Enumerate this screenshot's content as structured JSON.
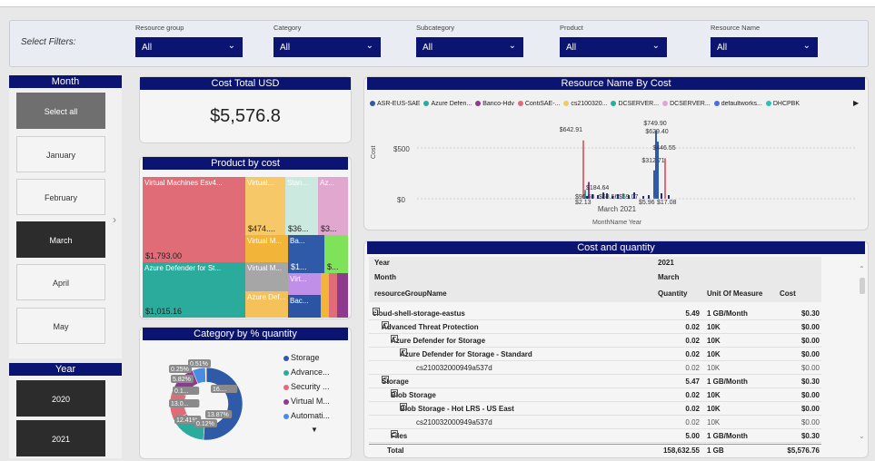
{
  "filters": {
    "label": "Select Filters:",
    "items": [
      {
        "label": "Resource group",
        "value": "All"
      },
      {
        "label": "Category",
        "value": "All"
      },
      {
        "label": "Subcategory",
        "value": "All"
      },
      {
        "label": "Product",
        "value": "All"
      },
      {
        "label": "Resource Name",
        "value": "All"
      }
    ]
  },
  "month_slicer": {
    "title": "Month",
    "items": [
      "Select all",
      "January",
      "February",
      "March",
      "April",
      "May"
    ],
    "selected": "March"
  },
  "year_slicer": {
    "title": "Year",
    "items": [
      "2020",
      "2021"
    ]
  },
  "cost_card": {
    "title": "Cost Total USD",
    "value": "$5,576.8"
  },
  "product_chart": {
    "title": "Product by cost",
    "tiles": [
      {
        "label": "Virtual Machines Esv4...",
        "value": "$1,793.00",
        "color": "#e06c78"
      },
      {
        "label": "Azure Defender for St...",
        "value": "$1,015.16",
        "color": "#2bab9b"
      },
      {
        "label": "Virtual...",
        "value": "$474....",
        "color": "#f7c867"
      },
      {
        "label": "Stan...",
        "value": "$36...",
        "color": "#cce9df"
      },
      {
        "label": "Az...",
        "value": "$3...",
        "color": "#e2a7ce"
      },
      {
        "label": "Virtual M...",
        "value": "",
        "color": "#f2b53a"
      },
      {
        "label": "Ba...",
        "value": "$1...",
        "color": "#2f5aa8"
      },
      {
        "label": "",
        "value": "$...",
        "color": "#7fe35a"
      },
      {
        "label": "Virtual M...",
        "value": "",
        "color": "#a6a6a6"
      },
      {
        "label": "Virt...",
        "value": "",
        "color": "#c08fe8"
      },
      {
        "label": "Azure Def...",
        "value": "",
        "color": "#f5c15b"
      },
      {
        "label": "Bac...",
        "value": "",
        "color": "#2b55a3"
      }
    ]
  },
  "category_chart": {
    "title": "Category by % quantity",
    "slices": [
      {
        "name": "Storage",
        "value": 51.0,
        "color": "#2f5aa8"
      },
      {
        "name": "Advance...",
        "value": 16.0,
        "color": "#2bab9b"
      },
      {
        "name": "Security ...",
        "value": 13.87,
        "color": "#e06c78"
      },
      {
        "name": "Virtual M...",
        "value": 12.41,
        "color": "#8e3a8e"
      },
      {
        "name": "Automati...",
        "value": 5.82,
        "color": "#4a8de0"
      },
      {
        "name": "",
        "value": 0.25,
        "color": "#f2b53a"
      },
      {
        "name": "",
        "value": 0.12,
        "color": "#999999"
      }
    ],
    "labels": [
      "0.51%",
      "0.25%",
      "5.82%",
      "0.1...",
      "16....",
      "13.0...",
      "13.87%",
      "12.41%",
      "0.12%"
    ]
  },
  "resource_chart": {
    "title": "Resource Name By Cost",
    "legend": [
      {
        "name": "ASR-EUS-SAE",
        "color": "#2f5aa8"
      },
      {
        "name": "Azure Defen...",
        "color": "#2bab9b"
      },
      {
        "name": "Banco-Hdv",
        "color": "#8e3a8e"
      },
      {
        "name": "ContiSAE-...",
        "color": "#e06c78"
      },
      {
        "name": "cs2100320...",
        "color": "#f2c867"
      },
      {
        "name": "DCSERVER...",
        "color": "#2bab9b"
      },
      {
        "name": "DCSERVER...",
        "color": "#e2a7ce"
      },
      {
        "name": "defaultworks...",
        "color": "#4a6de0"
      },
      {
        "name": "DHCPBK",
        "color": "#2bc1b8"
      }
    ],
    "ylabel": "Cost",
    "xlabel": "MonthName Year",
    "category": "March 2021",
    "yticks": [
      "$500",
      "$0"
    ],
    "data_labels": [
      "$749.90",
      "$642.91",
      "$629.40",
      "$446.55",
      "$312.71",
      "$184.64",
      "$96.60",
      "$68.56",
      "$59.07",
      "$5.96",
      "$17.08",
      "$2.13"
    ]
  },
  "chart_data": {
    "type": "bar",
    "title": "Resource Name By Cost",
    "xlabel": "MonthName Year",
    "ylabel": "Cost",
    "categories": [
      "March 2021"
    ],
    "values": [
      642.91,
      749.9,
      629.4,
      446.55,
      312.71,
      184.64,
      96.6,
      68.56,
      59.07,
      5.96,
      17.08,
      2.13
    ],
    "ylim": [
      0,
      800
    ]
  },
  "table": {
    "title": "Cost and quantity",
    "header": {
      "year_label": "Year",
      "year_value": "2021",
      "month_label": "Month",
      "month_value": "March",
      "rg_label": "resourceGroupName",
      "qty": "Quantity",
      "uom": "Unit Of Measure",
      "cost": "Cost"
    },
    "rows": [
      {
        "name": "cloud-shell-storage-eastus",
        "qty": "5.49",
        "uom": "1 GB/Month",
        "cost": "$0.30",
        "level": 0,
        "bold": true
      },
      {
        "name": "Advanced Threat Protection",
        "qty": "0.02",
        "uom": "10K",
        "cost": "$0.00",
        "level": 1,
        "bold": true
      },
      {
        "name": "Azure Defender for Storage",
        "qty": "0.02",
        "uom": "10K",
        "cost": "$0.00",
        "level": 2,
        "bold": true
      },
      {
        "name": "Azure Defender for Storage - Standard",
        "qty": "0.02",
        "uom": "10K",
        "cost": "$0.00",
        "level": 3,
        "bold": true
      },
      {
        "name": "cs210032000949a537d",
        "qty": "0.02",
        "uom": "10K",
        "cost": "$0.00",
        "level": 4,
        "bold": false
      },
      {
        "name": "Storage",
        "qty": "5.47",
        "uom": "1 GB/Month",
        "cost": "$0.30",
        "level": 1,
        "bold": true
      },
      {
        "name": "Blob Storage",
        "qty": "0.02",
        "uom": "10K",
        "cost": "$0.00",
        "level": 2,
        "bold": true
      },
      {
        "name": "Blob Storage - Hot LRS - US East",
        "qty": "0.02",
        "uom": "10K",
        "cost": "$0.00",
        "level": 3,
        "bold": true
      },
      {
        "name": "cs210032000949a537d",
        "qty": "0.02",
        "uom": "10K",
        "cost": "$0.00",
        "level": 4,
        "bold": false
      },
      {
        "name": "Files",
        "qty": "5.00",
        "uom": "1 GB/Month",
        "cost": "$0.30",
        "level": 2,
        "bold": true
      }
    ],
    "total": {
      "label": "Total",
      "qty": "158,632.55",
      "uom": "1 GB",
      "cost": "$5,576.76"
    }
  }
}
